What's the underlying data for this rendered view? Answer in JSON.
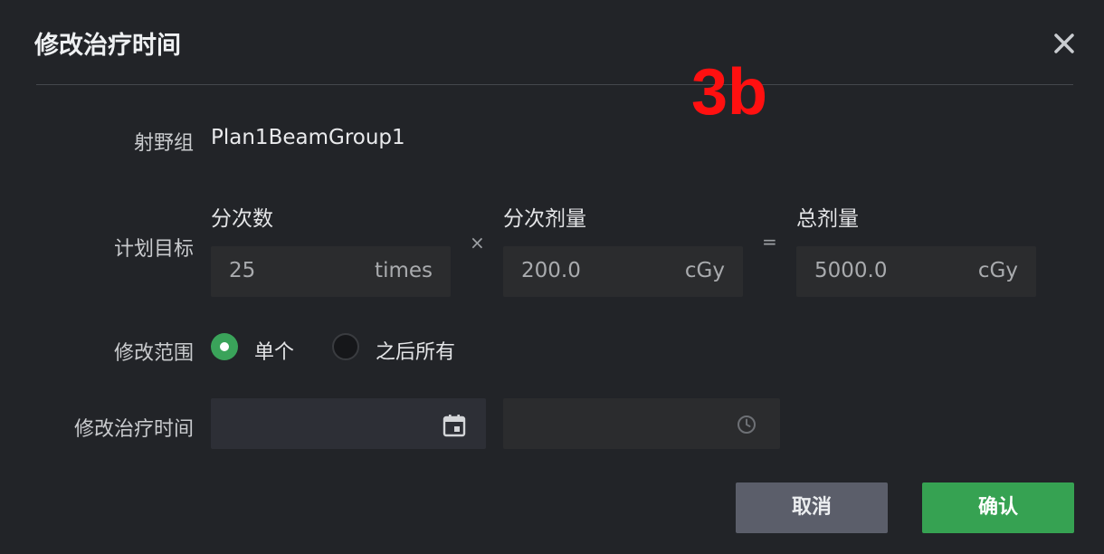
{
  "dialog": {
    "title": "修改治疗时间",
    "close_icon": "close-icon"
  },
  "annotation": "3b",
  "beam_group": {
    "label": "射野组",
    "value": "Plan1BeamGroup1"
  },
  "plan_target": {
    "label": "计划目标",
    "fractions": {
      "label": "分次数",
      "value": "25",
      "unit": "times"
    },
    "times_sign": "×",
    "fraction_dose": {
      "label": "分次剂量",
      "value": "200.0",
      "unit": "cGy"
    },
    "equals_sign": "=",
    "total_dose": {
      "label": "总剂量",
      "value": "5000.0",
      "unit": "cGy"
    }
  },
  "modify_scope": {
    "label": "修改范围",
    "options": [
      {
        "label": "单个",
        "selected": true
      },
      {
        "label": "之后所有",
        "selected": false
      }
    ]
  },
  "modify_time": {
    "label": "修改治疗时间",
    "date_value": "",
    "time_value": "",
    "date_icon": "calendar-icon",
    "time_icon": "clock-icon"
  },
  "buttons": {
    "cancel": "取消",
    "confirm": "确认"
  },
  "colors": {
    "background": "#222428",
    "accent_green": "#36a252",
    "cancel_gray": "#5b5e6a",
    "annotation_red": "#ff1010"
  }
}
